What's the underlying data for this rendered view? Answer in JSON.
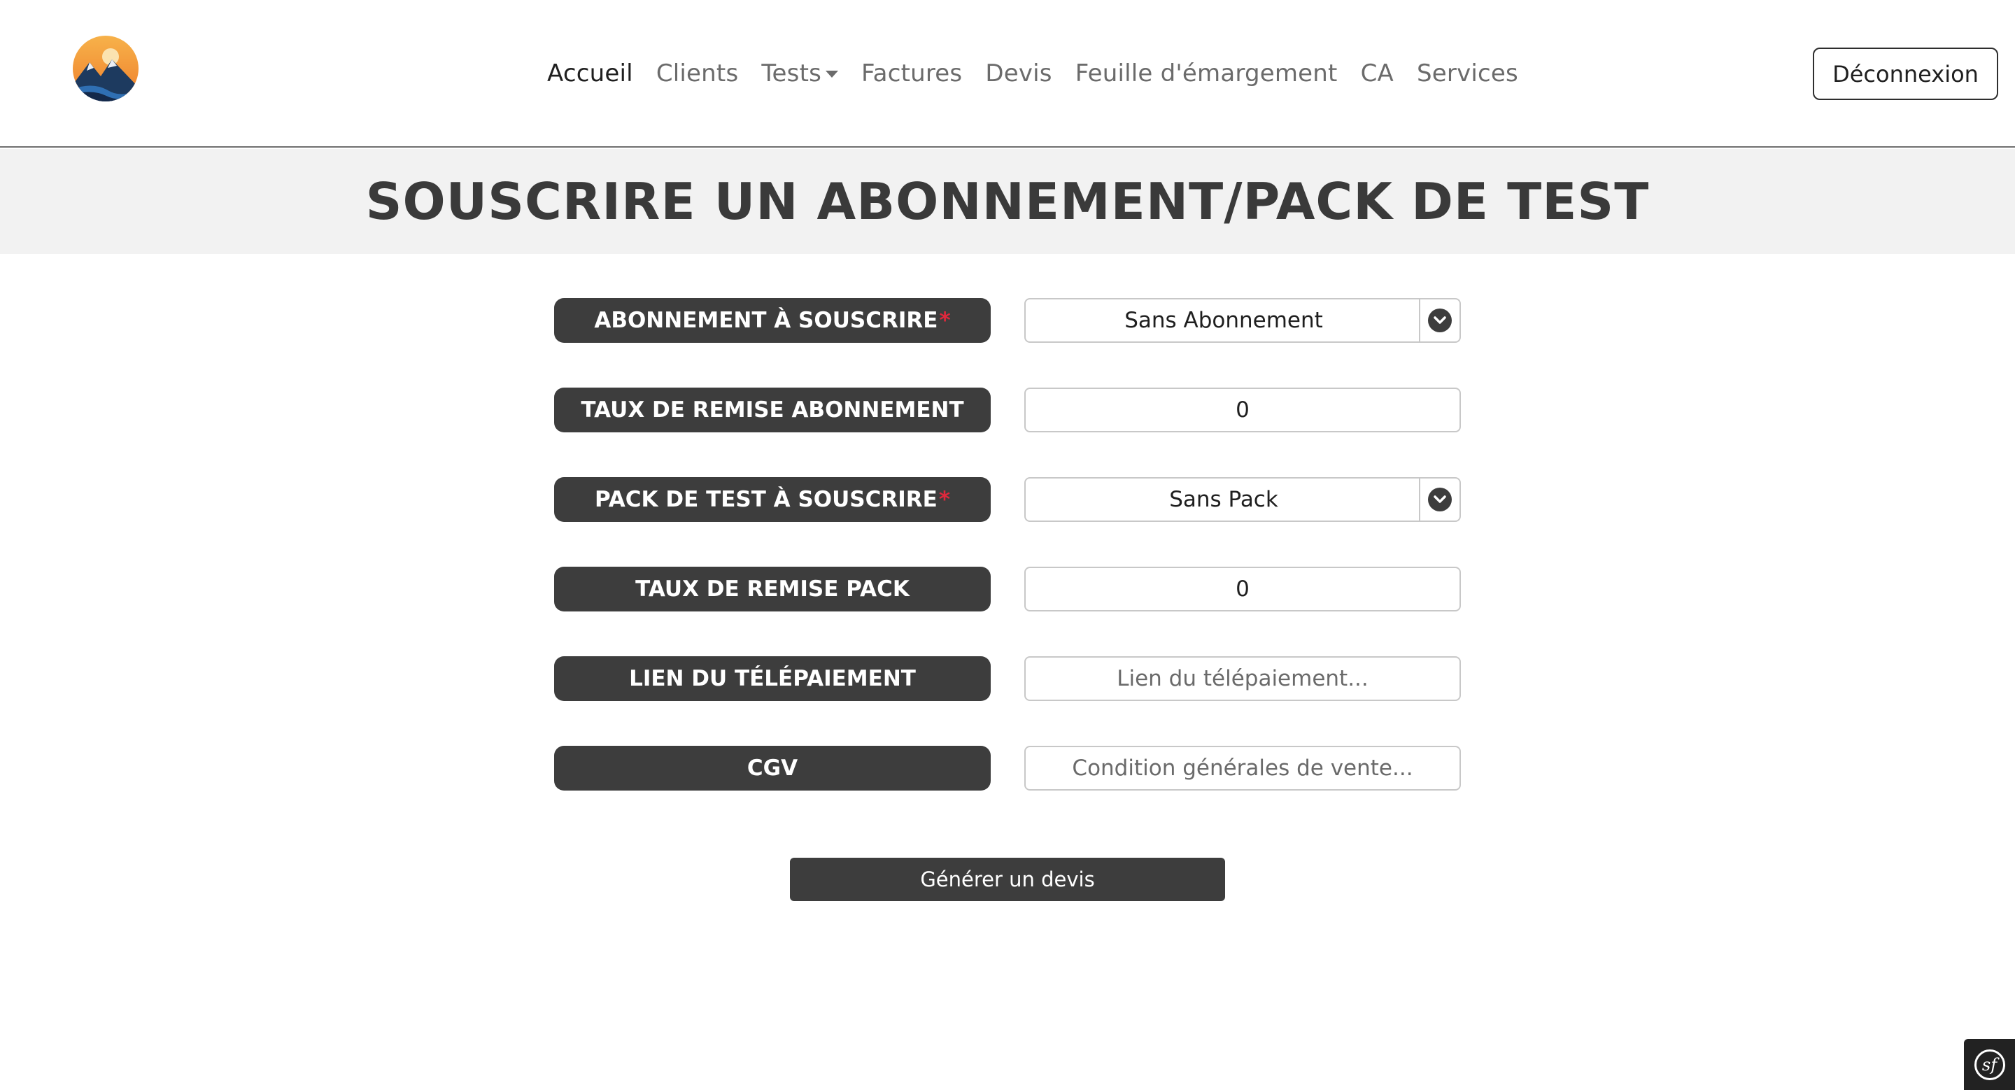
{
  "nav": {
    "items": [
      {
        "label": "Accueil",
        "active": true
      },
      {
        "label": "Clients",
        "active": false
      },
      {
        "label": "Tests",
        "active": false,
        "dropdown": true
      },
      {
        "label": "Factures",
        "active": false
      },
      {
        "label": "Devis",
        "active": false
      },
      {
        "label": "Feuille d'émargement",
        "active": false
      },
      {
        "label": "CA",
        "active": false
      },
      {
        "label": "Services",
        "active": false
      }
    ],
    "logout_label": "Déconnexion"
  },
  "page": {
    "title": "SOUSCRIRE UN ABONNEMENT/PACK DE TEST"
  },
  "form": {
    "subscription": {
      "label": "ABONNEMENT À SOUSCRIRE",
      "required_mark": "*",
      "value": "Sans Abonnement"
    },
    "subscription_discount": {
      "label": "TAUX DE REMISE ABONNEMENT",
      "value": "0"
    },
    "pack": {
      "label": "PACK DE TEST À SOUSCRIRE",
      "required_mark": "*",
      "value": "Sans Pack"
    },
    "pack_discount": {
      "label": "TAUX DE REMISE PACK",
      "value": "0"
    },
    "payment_link": {
      "label": "LIEN DU TÉLÉPAIEMENT",
      "placeholder": "Lien du télépaiement..."
    },
    "cgv": {
      "label": "CGV",
      "placeholder": "Condition générales de vente..."
    },
    "submit_label": "Générer un devis"
  },
  "debug_toolbar": {
    "icon": "symfony-icon",
    "glyph": "sf"
  },
  "colors": {
    "dark": "#3d3d3d",
    "required": "#e0283c",
    "title_band": "#f2f2f2",
    "logo_sun": "#f2a33a",
    "logo_mountain": "#1d3a5f"
  }
}
